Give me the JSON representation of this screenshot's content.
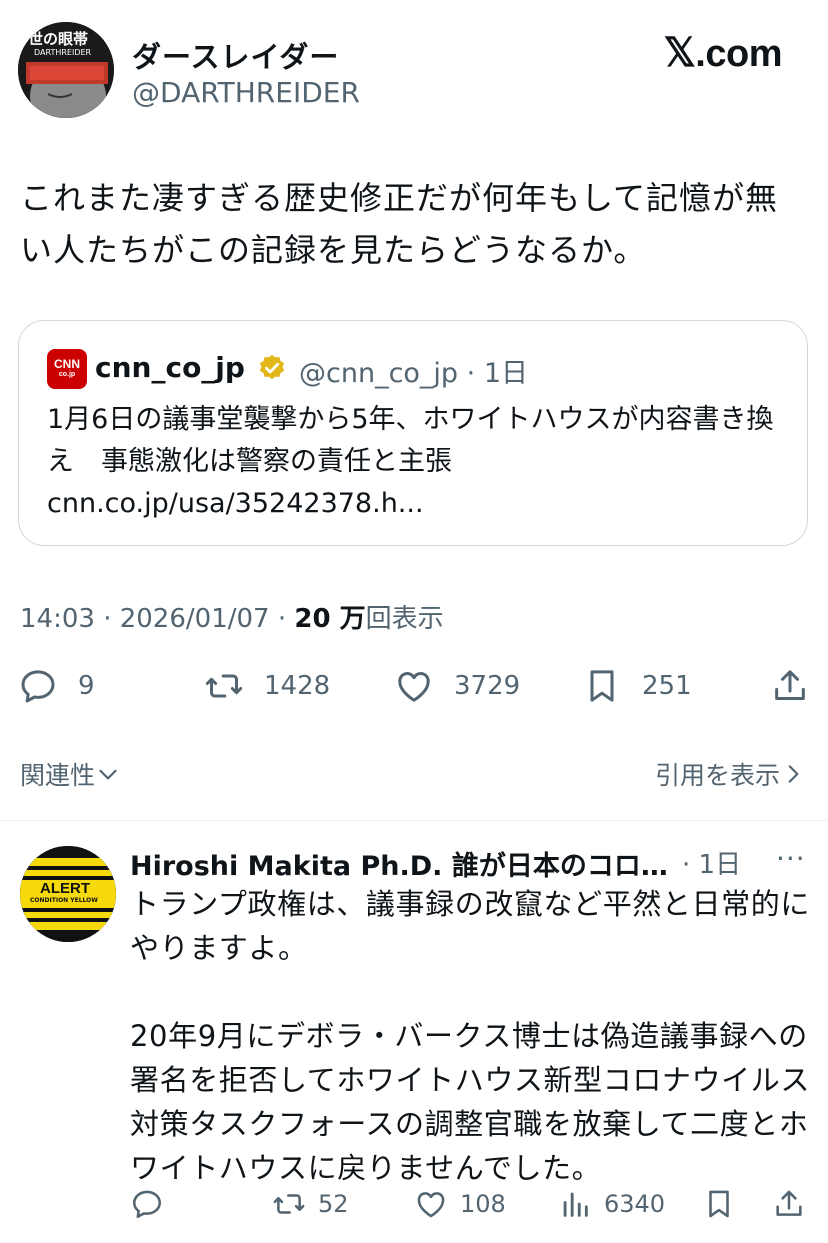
{
  "author": {
    "display_name": "ダースレイダー",
    "handle": "@DARTHREIDER",
    "avatar_text": "DARTHREIDER",
    "avatar_kanji": "世の眼帯"
  },
  "brand": {
    "x_mark": "𝕏",
    "domain": ".com"
  },
  "post": {
    "text": "これまた凄すぎる歴史修正だが何年もして記憶が無い人たちがこの記録を見たらどうなるか。"
  },
  "quote": {
    "logo_text": "CNN",
    "logo_sub": "co.jp",
    "name": "cnn_co_jp",
    "handle_time": "@cnn_co_jp · 1日",
    "text": "1月6日の議事堂襲撃から5年、ホワイトハウスが内容書き換え　事態激化は警察の責任と主張 cnn.co.jp/usa/35242378.h..."
  },
  "meta": {
    "time_date": "14:03 · 2026/01/07 · ",
    "views_count": "20 万",
    "views_label": "回表示"
  },
  "actions": {
    "replies": "9",
    "reposts": "1428",
    "likes": "3729",
    "bookmarks": "251"
  },
  "section": {
    "left_label": "関連性",
    "right_label": "引用を表示"
  },
  "reply": {
    "name": "Hiroshi Makita Ph.D. 誰が日本のコロ…",
    "time": "· 1日",
    "more": "···",
    "avatar_line1": "ALERT",
    "avatar_line2": "CONDITION YELLOW",
    "text_p1": "トランプ政権は、議事録の改竄など平然と日常的にやりますよ。",
    "text_p2": "20年9月にデボラ・バークス博士は偽造議事録への署名を拒否してホワイトハウス新型コロナウイルス対策タスクフォースの調整官職を放棄して二度とホワイトハウスに戻りませんでした。",
    "reposts": "52",
    "likes": "108",
    "views": "6340"
  },
  "colors": {
    "text": "#0f1419",
    "muted": "#536471",
    "border": "#cfd9de",
    "badge_gold": "#e2b719",
    "cnn_red": "#cc0000",
    "alert_yellow": "#f5d90a"
  }
}
